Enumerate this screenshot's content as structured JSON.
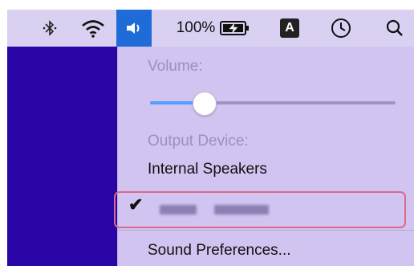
{
  "menubar": {
    "items": [
      {
        "name": "bluetooth-icon",
        "glyph": "✱"
      },
      {
        "name": "wifi-icon"
      },
      {
        "name": "volume-icon",
        "active": true
      },
      {
        "name": "battery-status",
        "text": "100%"
      },
      {
        "name": "input-source",
        "text": "A"
      },
      {
        "name": "clock-icon"
      },
      {
        "name": "search-icon"
      }
    ]
  },
  "volume_menu": {
    "volume_label": "Volume:",
    "volume_level": 0.22,
    "output_label": "Output Device:",
    "devices": [
      {
        "label": "Internal Speakers",
        "selected": false
      },
      {
        "label": "",
        "selected": true,
        "obscured": true
      }
    ],
    "checkmark": "✔",
    "sound_preferences": "Sound Preferences..."
  },
  "colors": {
    "accent": "#1f6bd8",
    "slider_fill": "#4fa0ff",
    "highlight_border": "#d96a8c",
    "desktop": "#2a06a6",
    "menu_bg": "#d1c4f0"
  }
}
